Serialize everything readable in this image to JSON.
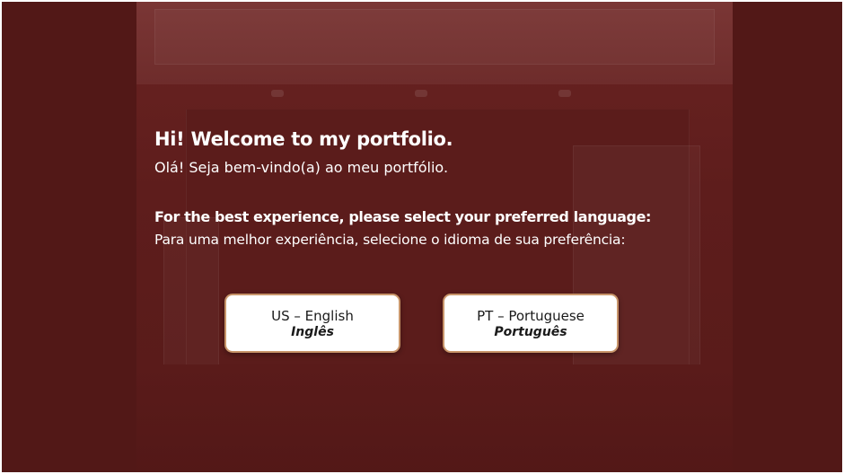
{
  "welcome": {
    "title_en": "Hi! Welcome to my portfolio.",
    "title_pt": "Olá! Seja bem-vindo(a) ao meu portfólio.",
    "prompt_en": "For the best experience, please select your preferred language:",
    "prompt_pt": "Para uma melhor experiência, selecione o idioma de sua preferência:"
  },
  "languages": [
    {
      "label": "US – English",
      "native": "Inglês"
    },
    {
      "label": "PT – Portuguese",
      "native": "Português"
    }
  ],
  "colors": {
    "overlay": "#5a1a1a",
    "button_border": "#c8956a",
    "text": "#ffffff"
  }
}
